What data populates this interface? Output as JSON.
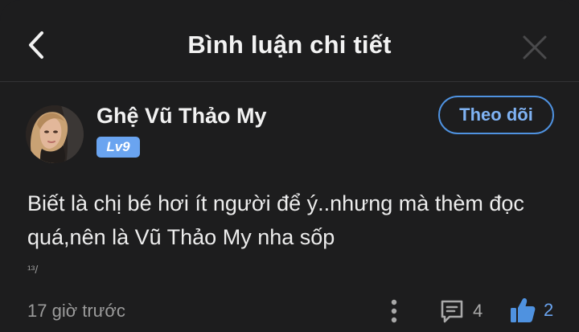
{
  "header": {
    "title": "Bình luận chi tiết"
  },
  "comment": {
    "user_name": "Ghệ Vũ Thảo My",
    "level": "Lv9",
    "follow_label": "Theo dõi",
    "text": "Biết là chị bé hơi ít người để ý..nhưng mà thèm đọc quá,nên là Vũ Thảo My nha sốp",
    "footnote": "¹³/",
    "time": "17 giờ trước",
    "reply_count": "4",
    "like_count": "2"
  },
  "colors": {
    "background": "#1d1d1e",
    "accent": "#4f92e0",
    "level_badge": "#6aa4f0"
  },
  "icons": {
    "back": "chevron-left-icon",
    "close": "close-icon",
    "more": "more-vertical-icon",
    "reply": "comment-icon",
    "like": "thumbs-up-icon"
  }
}
